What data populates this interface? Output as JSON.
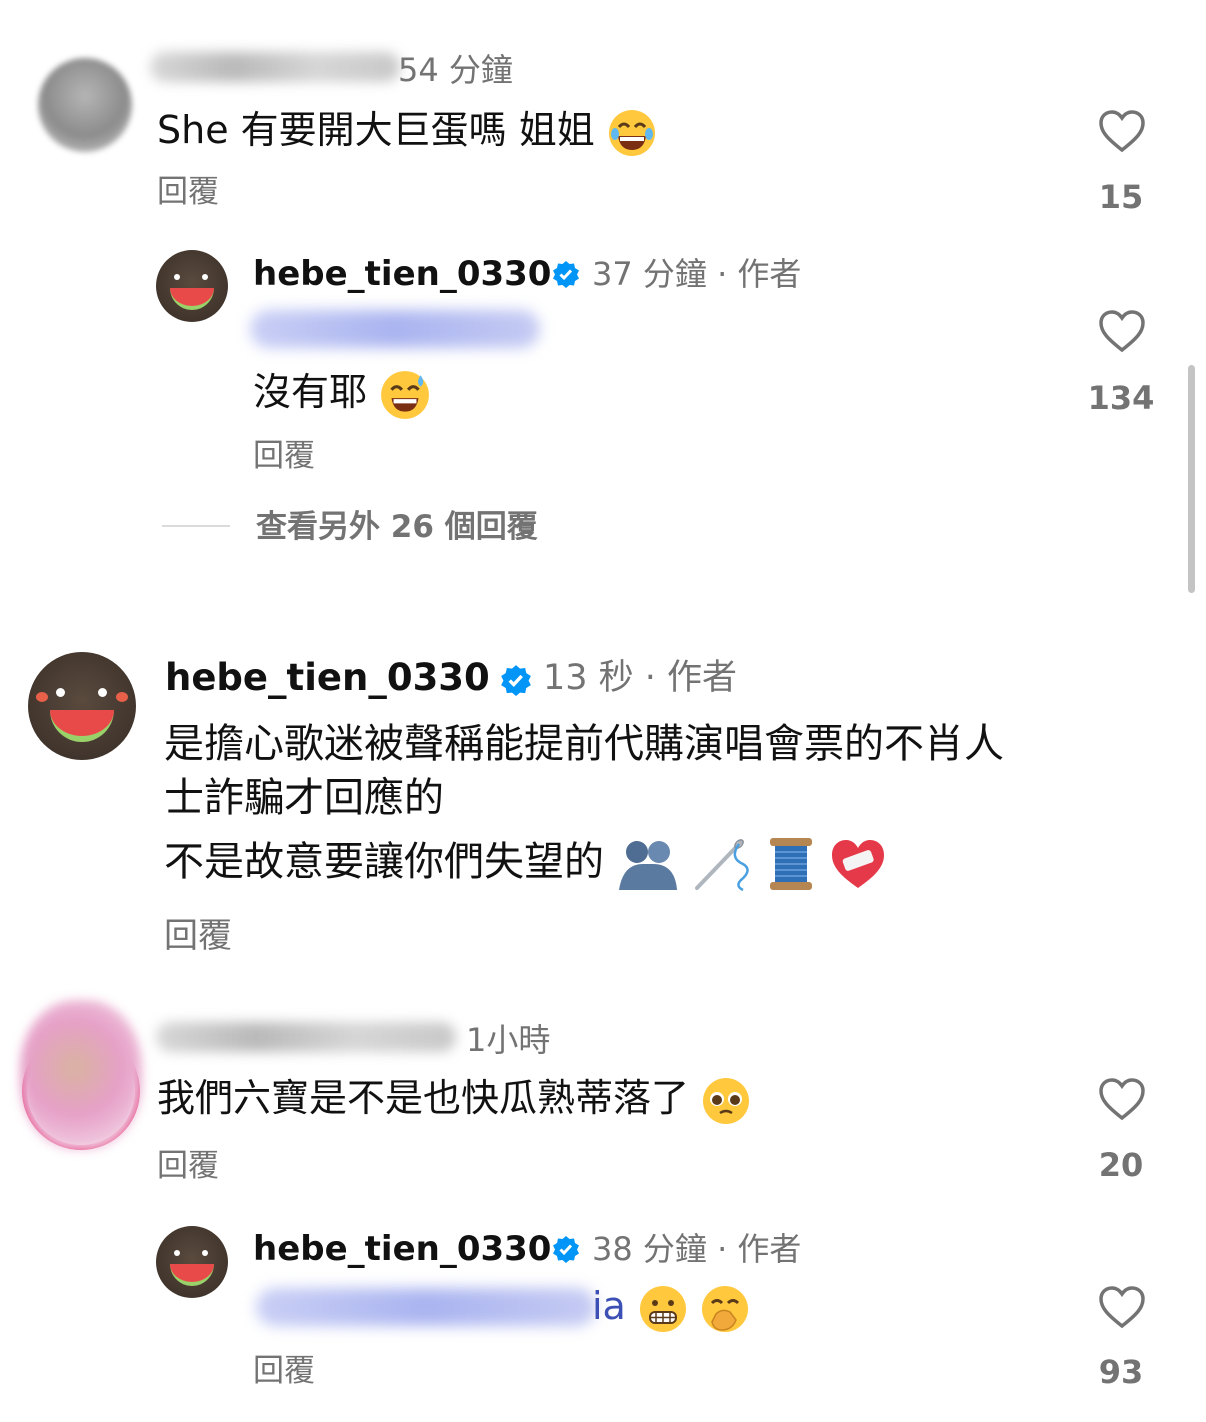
{
  "comments": [
    {
      "time": "54 分鐘",
      "text": "She 有要開大巨蛋嗎 姐姐",
      "emoji": "laughing",
      "reply_label": "回覆",
      "likes": "15",
      "replies": [
        {
          "username": "hebe_tien_0330",
          "time_author": "37 分鐘 · 作者",
          "text": "沒有耶",
          "emoji": "sweat-smile",
          "reply_label": "回覆",
          "likes": "134"
        }
      ],
      "view_more": "查看另外 26 個回覆"
    },
    {
      "username": "hebe_tien_0330",
      "time_author": "13 秒 · 作者",
      "line1": "是擔心歌迷被聲稱能提前代購演唱會票的不肖人",
      "line2": "士詐騙才回應的",
      "line3": "不是故意要讓你們失望的",
      "reply_label": "回覆"
    },
    {
      "time": "1小時",
      "text": "我們六寶是不是也快瓜熟蒂落了",
      "emoji": "pleading",
      "reply_label": "回覆",
      "likes": "20",
      "replies": [
        {
          "username": "hebe_tien_0330",
          "time_author": "38 分鐘 · 作者",
          "mention_tail": "ia",
          "reply_label": "回覆",
          "likes": "93"
        }
      ]
    }
  ],
  "colors": {
    "verified": "#0095f6",
    "meta": "#737373",
    "mention": "#3b4fb4"
  }
}
